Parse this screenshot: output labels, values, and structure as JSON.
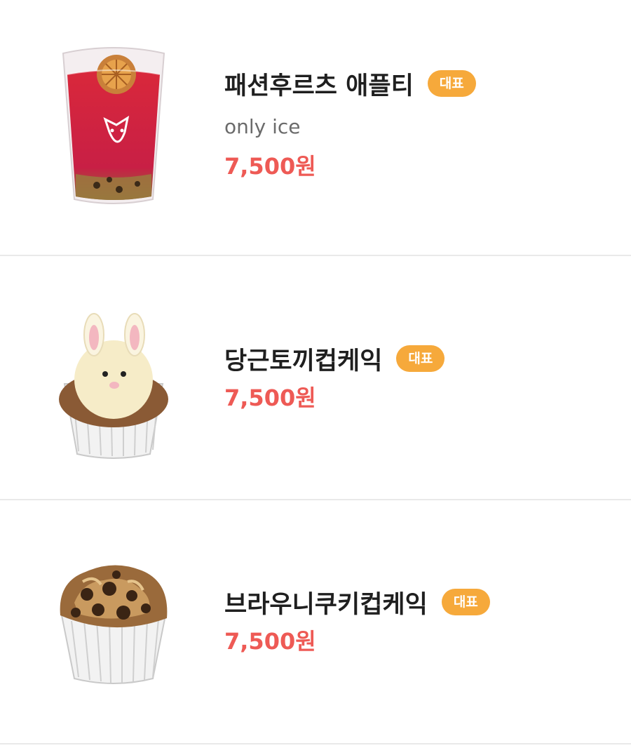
{
  "menu": {
    "items": [
      {
        "name": "패션후르츠 애플티",
        "badge": "대표",
        "description": "only ice",
        "price": "7,500원",
        "image_icon": "iced-tea-cup-image"
      },
      {
        "name": "당근토끼컵케익",
        "badge": "대표",
        "description": "",
        "price": "7,500원",
        "image_icon": "bunny-cupcake-image"
      },
      {
        "name": "브라우니쿠키컵케익",
        "badge": "대표",
        "description": "",
        "price": "7,500원",
        "image_icon": "brownie-cupcake-image"
      }
    ]
  },
  "colors": {
    "badge": "#f6a93b",
    "price": "#ee5a55",
    "divider": "#e9e9e9"
  }
}
